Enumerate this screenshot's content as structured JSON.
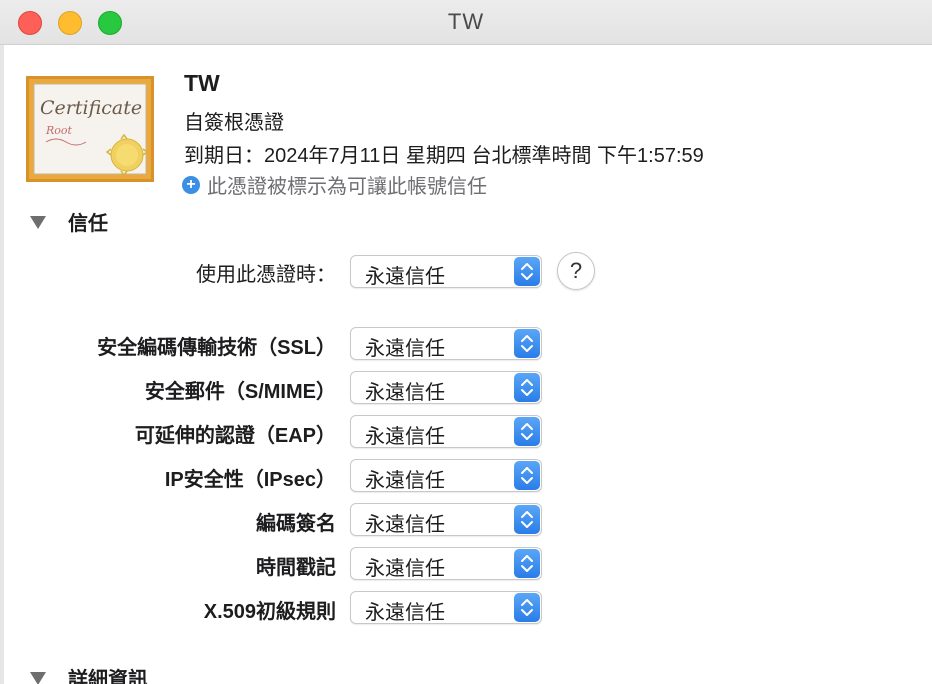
{
  "window": {
    "title": "TW"
  },
  "certificate": {
    "name": "TW",
    "type": "自簽根憑證",
    "expiry": "到期日：2024年7月11日 星期四 台北標準時間 下午1:57:59",
    "status": "此憑證被標示為可讓此帳號信任",
    "icon_text_primary": "Certificate",
    "icon_text_secondary": "Root"
  },
  "trust_section": {
    "title": "信任",
    "when_using_label": "使用此憑證時：",
    "when_using_value": "永遠信任",
    "help_label": "?",
    "rows": [
      {
        "label": "安全編碼傳輸技術（SSL）",
        "value": "永遠信任"
      },
      {
        "label": "安全郵件（S/MIME）",
        "value": "永遠信任"
      },
      {
        "label": "可延伸的認證（EAP）",
        "value": "永遠信任"
      },
      {
        "label": "IP安全性（IPsec）",
        "value": "永遠信任"
      },
      {
        "label": "編碼簽名",
        "value": "永遠信任"
      },
      {
        "label": "時間戳記",
        "value": "永遠信任"
      },
      {
        "label": "X.509初級規則",
        "value": "永遠信任"
      }
    ]
  },
  "details_section": {
    "title": "詳細資訊"
  },
  "icons": {
    "disclosure": "disclosure-triangle-icon",
    "status": "plus-circle-icon",
    "popup": "up-down-chevron-icon",
    "help": "question-mark-icon"
  },
  "colors": {
    "close": "#fe5f57",
    "minimize": "#febc2e",
    "maximize": "#28c840",
    "accent": "#3b8fe4",
    "certificate_frame": "#d8922b"
  }
}
